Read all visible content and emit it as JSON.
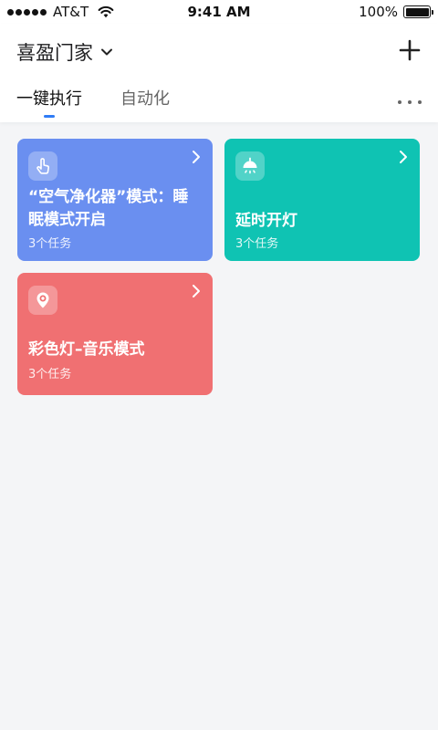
{
  "status_bar": {
    "carrier": "AT&T",
    "time": "9:41 AM",
    "battery": "100%",
    "battery_level": 1.0
  },
  "header": {
    "home_name": "喜盈门家",
    "tabs": [
      {
        "label": "一键执行",
        "active": true
      },
      {
        "label": "自动化",
        "active": false
      }
    ]
  },
  "scenes": [
    {
      "title": "“空气净化器”模式：睡眠模式开启",
      "tasks": "3个任务",
      "color": "#6a8ff0",
      "icon": "touch-hand-icon"
    },
    {
      "title": "延时开灯",
      "tasks": "3个任务",
      "color": "#0fc3b3",
      "icon": "ceiling-lamp-icon"
    },
    {
      "title": "彩色灯–音乐模式",
      "tasks": "3个任务",
      "color": "#f07072",
      "icon": "location-pin-icon"
    }
  ],
  "colors": {
    "accent": "#2f7cf6",
    "background": "#f4f5f7"
  }
}
